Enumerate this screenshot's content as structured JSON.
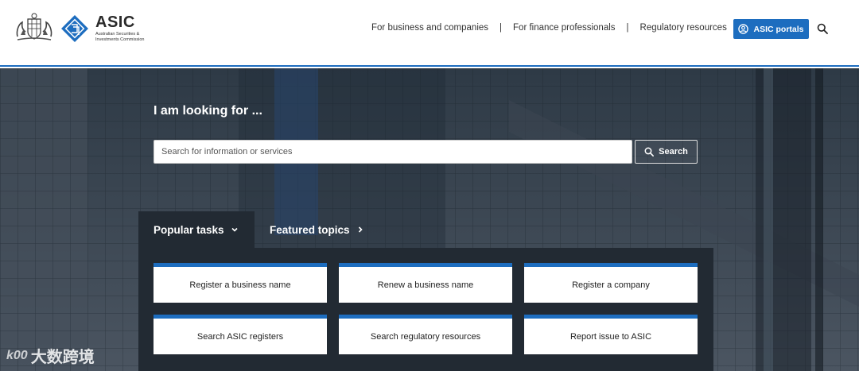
{
  "header": {
    "logo_title": "ASIC",
    "logo_subtitle": "Australian Securities & Investments Commission",
    "nav": [
      {
        "label": "For business and companies"
      },
      {
        "label": "For finance professionals"
      },
      {
        "label": "Regulatory resources"
      }
    ],
    "nav_separator": "|",
    "portals_label": "ASIC portals"
  },
  "hero": {
    "title": "I am looking for ...",
    "search_placeholder": "Search for information or services",
    "search_value": "",
    "search_button": "Search"
  },
  "tabs": {
    "popular": "Popular tasks",
    "featured": "Featured topics"
  },
  "tasks": [
    {
      "label": "Register a business name"
    },
    {
      "label": "Renew a business name"
    },
    {
      "label": "Register a company"
    },
    {
      "label": "Search ASIC registers"
    },
    {
      "label": "Search regulatory resources"
    },
    {
      "label": "Report issue to ASIC"
    }
  ],
  "watermark": {
    "mark": "k00",
    "text": "大数跨境"
  },
  "colors": {
    "brand_blue": "#1d6dbf",
    "panel_dark": "#222a33",
    "hero_bg": "#3f4a56"
  },
  "icons": {
    "portals": "user-circle-icon",
    "search": "search-icon",
    "popular_tab": "chevron-down-icon",
    "featured_tab": "chevron-right-icon"
  }
}
